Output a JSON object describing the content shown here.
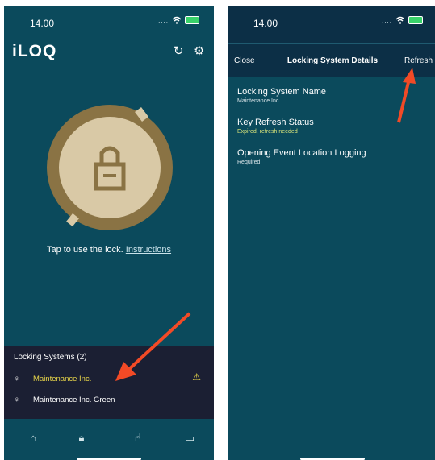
{
  "left": {
    "status": {
      "time": "14.00"
    },
    "app": {
      "logo": "iLOQ",
      "icons": [
        "refresh-icon",
        "gear-icon"
      ]
    },
    "lock": {
      "icon": "padlock-icon",
      "instruction_text": "Tap to use the lock.",
      "instruction_link": "Instructions"
    },
    "systems": {
      "title": "Locking Systems (2)",
      "items": [
        {
          "name": "Maintenance Inc.",
          "status_icon": "warning-icon",
          "color": "#e8d64a"
        },
        {
          "name": "Maintenance Inc. Green",
          "color": "#ffffff"
        }
      ]
    },
    "nav": [
      "home-icon",
      "lock-icon",
      "touch-icon",
      "message-icon"
    ]
  },
  "right": {
    "status": {
      "time": "14.00"
    },
    "header": {
      "close": "Close",
      "title": "Locking System Details",
      "refresh": "Refresh"
    },
    "fields": [
      {
        "label": "Locking System Name",
        "value": "Maintenance Inc."
      },
      {
        "label": "Key Refresh Status",
        "value": "Expired, refresh needed"
      },
      {
        "label": "Opening Event Location Logging",
        "value": "Required"
      }
    ]
  },
  "colors": {
    "background": "#0b4a5c",
    "annotation_arrow": "#f24a26",
    "accent_gold": "#8a7344",
    "warning": "#e8d64a"
  }
}
